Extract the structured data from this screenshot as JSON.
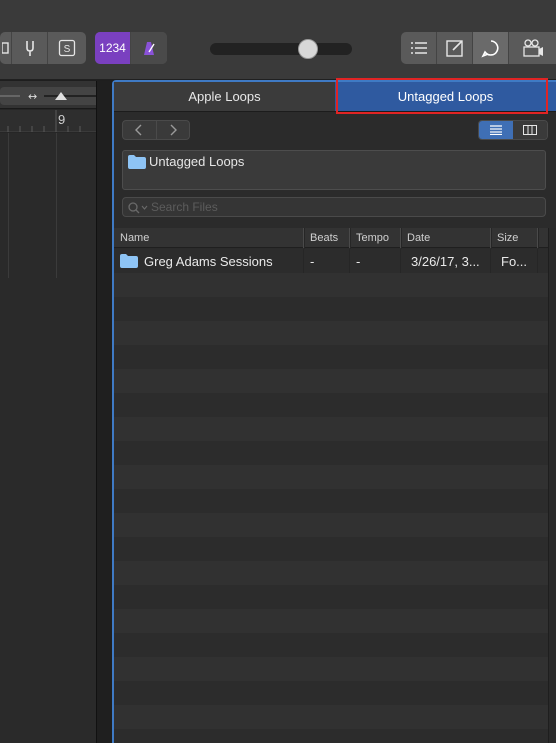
{
  "toolbar": {
    "lcd_label": "1234"
  },
  "ruler": {
    "bar_number": "9"
  },
  "browser": {
    "tabs": [
      {
        "label": "Apple Loops"
      },
      {
        "label": "Untagged Loops"
      }
    ],
    "path_label": "Untagged Loops",
    "search_placeholder": "Search Files",
    "columns": [
      "Name",
      "Beats",
      "Tempo",
      "Date",
      "Size"
    ],
    "rows": [
      {
        "name": "Greg Adams Sessions",
        "beats": "-",
        "tempo": "-",
        "date": "3/26/17, 3...",
        "size": "Fo..."
      }
    ]
  },
  "colors": {
    "selected_tab": "#2f5aa0",
    "highlight_outline": "#e02424",
    "folder_icon": "#8ec4f5",
    "lcd_purple": "#7a40c0"
  }
}
